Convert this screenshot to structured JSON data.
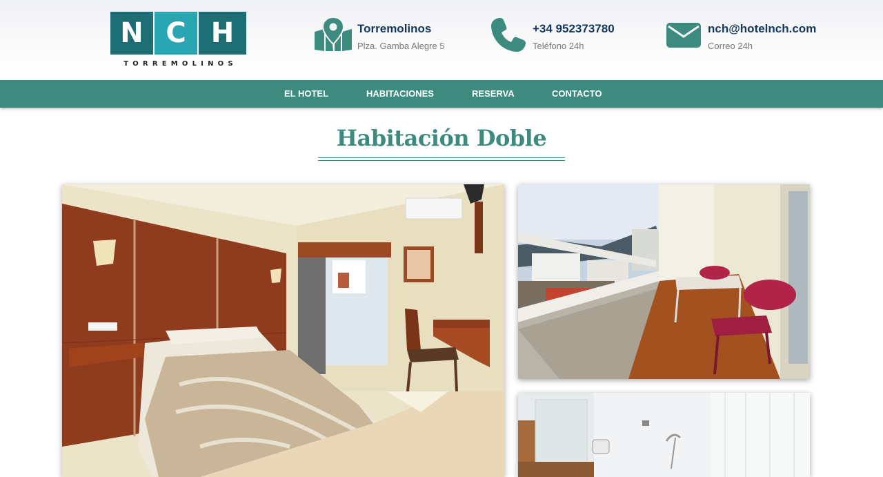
{
  "logo": {
    "letters": [
      "N",
      "C",
      "H"
    ],
    "subtitle": "TORREMOLINOS",
    "colors": {
      "dark": "#1d6e74",
      "light": "#2aa6b2"
    }
  },
  "contact": [
    {
      "icon": "map-pin-icon",
      "title": "Torremolinos",
      "subtitle": "Plza. Gamba Alegre 5"
    },
    {
      "icon": "phone-icon",
      "title": "+34 952373780",
      "subtitle": "Teléfono 24h"
    },
    {
      "icon": "envelope-icon",
      "title": "nch@hotelnch.com",
      "subtitle": "Correo 24h"
    }
  ],
  "nav": {
    "items": [
      "EL HOTEL",
      "HABITACIONES",
      "RESERVA",
      "CONTACTO"
    ],
    "background": "#3d8a7e"
  },
  "page": {
    "title": "Habitación Doble",
    "accent": "#3d8a7e"
  },
  "gallery": [
    {
      "icon": "bedroom-photo"
    },
    {
      "icon": "balcony-photo"
    },
    {
      "icon": "bathroom-photo"
    }
  ]
}
